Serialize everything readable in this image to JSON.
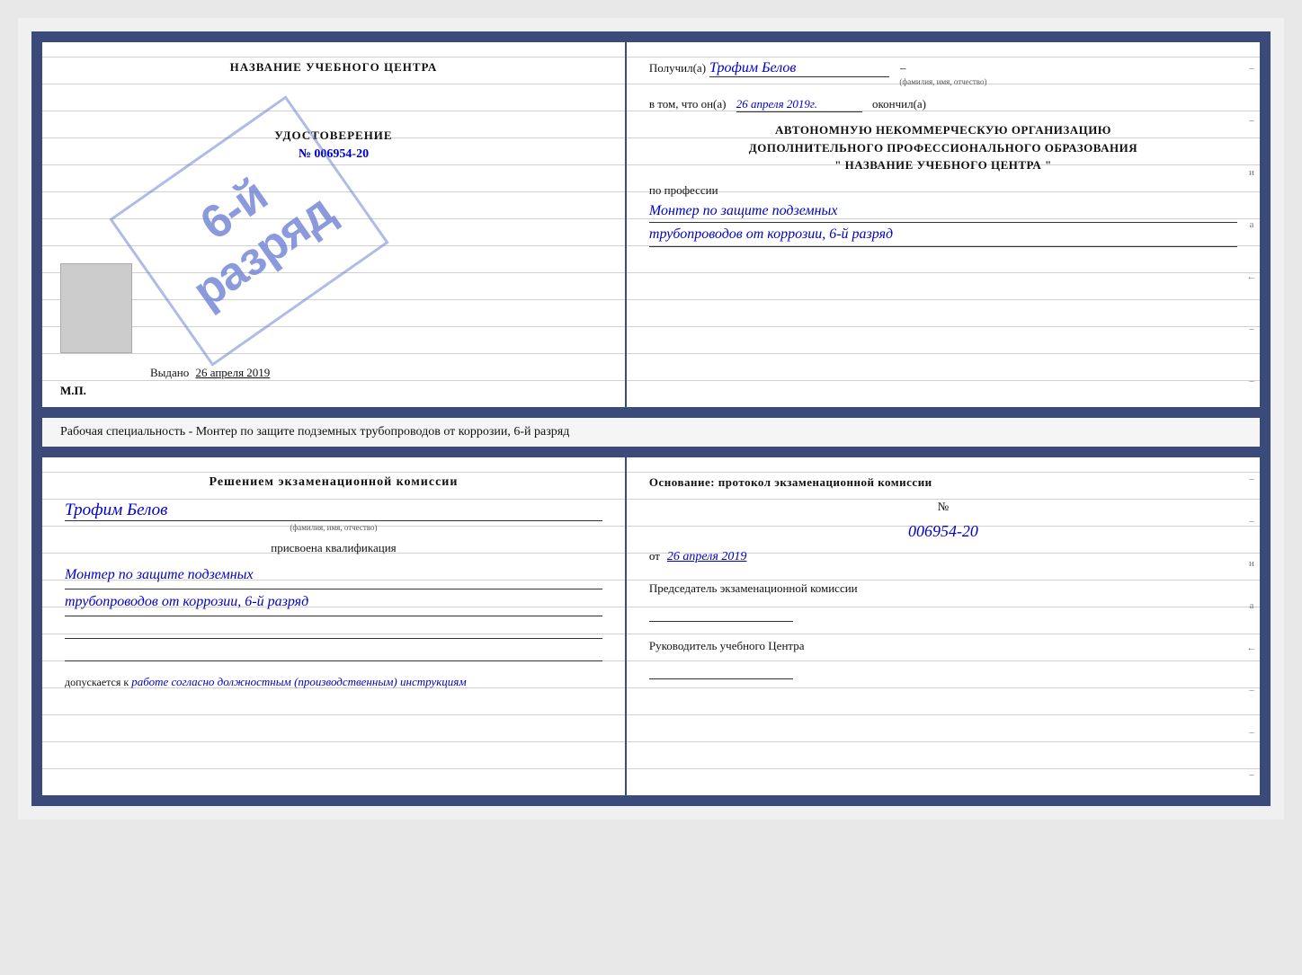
{
  "page": {
    "background": "#e8e8e8"
  },
  "top_cert": {
    "left": {
      "title": "НАЗВАНИЕ УЧЕБНОГО ЦЕНТРА",
      "stamp_line1": "6-й",
      "stamp_line2": "разряд",
      "udost_label": "УДОСТОВЕРЕНИЕ",
      "udost_number_prefix": "№",
      "udost_number": "006954-20",
      "vydano_label": "Выдано",
      "vydano_date": "26 апреля 2019",
      "mp_label": "М.П."
    },
    "right": {
      "poluchil_label": "Получил(а)",
      "recipient_name": "Трофим Белов",
      "fio_hint": "(фамилия, имя, отчество)",
      "dash": "–",
      "vtom_label": "в том, что он(а)",
      "date_value": "26 апреля 2019г.",
      "okonchil_label": "окончил(а)",
      "org_line1": "АВТОНОМНУЮ НЕКОММЕРЧЕСКУЮ ОРГАНИЗАЦИЮ",
      "org_line2": "ДОПОЛНИТЕЛЬНОГО ПРОФЕССИОНАЛЬНОГО ОБРАЗОВАНИЯ",
      "org_quote_open": "\"",
      "org_name": "НАЗВАНИЕ УЧЕБНОГО ЦЕНТРА",
      "org_quote_close": "\"",
      "po_professii_label": "по профессии",
      "profession_line1": "Монтер по защите подземных",
      "profession_line2": "трубопроводов от коррозии, 6-й разряд"
    }
  },
  "middle": {
    "text": "Рабочая специальность - Монтер по защите подземных трубопроводов от коррозии, 6-й разряд"
  },
  "bottom_cert": {
    "left": {
      "resheniem_label": "Решением экзаменационной комиссии",
      "recipient_name": "Трофим Белов",
      "fio_hint": "(фамилия, имя, отчество)",
      "prisvoena_label": "присвоена квалификация",
      "qual_line1": "Монтер по защите подземных",
      "qual_line2": "трубопроводов от коррозии, 6-й разряд",
      "dopuskaetsya_label": "допускается к",
      "dopusk_text": "работе согласно должностным (производственным) инструкциям"
    },
    "right": {
      "osnovanie_label": "Основание: протокол экзаменационной комиссии",
      "number_prefix": "№",
      "number_value": "006954-20",
      "ot_label": "от",
      "ot_date": "26 апреля 2019",
      "predsedatel_label": "Председатель экзаменационной комиссии",
      "rukovoditel_label": "Руководитель учебного Центра"
    }
  },
  "side_marks": {
    "items": [
      "–",
      "–",
      "и",
      "а",
      "←",
      "–",
      "–",
      "–",
      "–"
    ]
  }
}
